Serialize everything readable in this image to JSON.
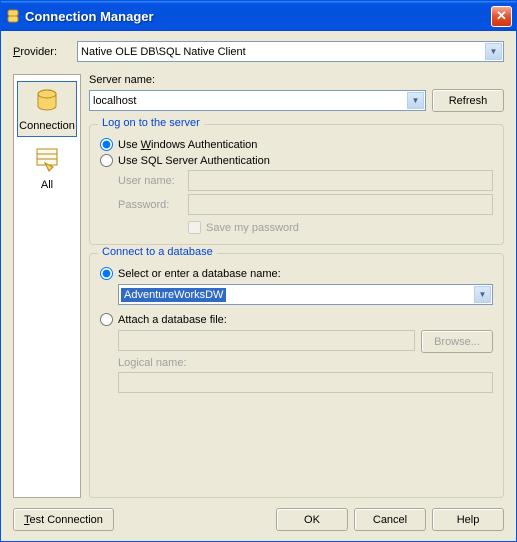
{
  "window": {
    "title": "Connection Manager"
  },
  "provider": {
    "label": "Provider:",
    "value": "Native OLE DB\\SQL Native Client"
  },
  "sidebar": {
    "items": [
      {
        "label": "Connection"
      },
      {
        "label": "All"
      }
    ]
  },
  "server": {
    "label": "Server name:",
    "value": "localhost",
    "refresh": "Refresh"
  },
  "logon": {
    "legend": "Log on to the server",
    "windows_auth": "Use Windows Authentication",
    "sql_auth": "Use SQL Server Authentication",
    "username_label": "User name:",
    "password_label": "Password:",
    "save_password": "Save my password"
  },
  "database": {
    "legend": "Connect to a database",
    "select_label": "Select or enter a database name:",
    "selected_db": "AdventureWorksDW",
    "attach_label": "Attach a database file:",
    "browse": "Browse...",
    "logical_label": "Logical name:"
  },
  "footer": {
    "test": "Test Connection",
    "ok": "OK",
    "cancel": "Cancel",
    "help": "Help"
  }
}
